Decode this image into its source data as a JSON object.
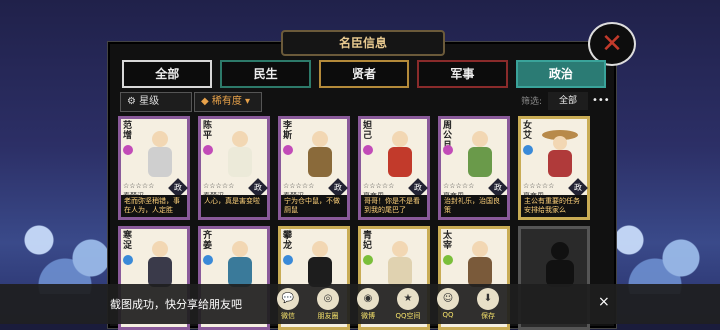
{
  "window": {
    "title": "名臣信息"
  },
  "tabs": [
    {
      "label": "全部"
    },
    {
      "label": "民生"
    },
    {
      "label": "贤者"
    },
    {
      "label": "军事"
    },
    {
      "label": "政治"
    }
  ],
  "toolbar": {
    "star_label": "星级",
    "rarity_label": "稀有度",
    "filter_label": "筛选:",
    "filter_value": "全部",
    "more_label": "•••"
  },
  "cards": [
    {
      "name": "范增",
      "dynasty": "秦楚汉",
      "badge": "政",
      "desc": "老而弥坚稍错，事在人为，人定胜",
      "frame": "purple"
    },
    {
      "name": "陈平",
      "dynasty": "秦楚汉",
      "badge": "政",
      "desc": "人心，真是害变啦",
      "frame": "purple"
    },
    {
      "name": "李斯",
      "dynasty": "秦楚汉",
      "badge": "政",
      "desc": "宁为仓中鼠，不做厕鼠",
      "frame": "purple"
    },
    {
      "name": "妲己",
      "dynasty": "夏商周",
      "badge": "政",
      "desc": "哥哥！你是不是看到我的尾巴了",
      "frame": "purple"
    },
    {
      "name": "周公旦",
      "dynasty": "夏商周",
      "badge": "政",
      "desc": "治封礼乐，治国良策",
      "frame": "purple"
    },
    {
      "name": "女艾",
      "dynasty": "夏商周",
      "badge": "政",
      "desc": "主公有重要的任务安排给我家么",
      "frame": "gold"
    },
    {
      "name": "寒浞",
      "dynasty": "",
      "badge": "",
      "desc": "",
      "frame": "purple"
    },
    {
      "name": "齐姜",
      "dynasty": "",
      "badge": "",
      "desc": "",
      "frame": "purple"
    },
    {
      "name": "攀龙",
      "dynasty": "",
      "badge": "",
      "desc": "",
      "frame": "gold"
    },
    {
      "name": "青妃",
      "dynasty": "",
      "badge": "",
      "desc": "",
      "frame": "gold"
    },
    {
      "name": "太宰",
      "dynasty": "",
      "badge": "",
      "desc": "",
      "frame": "gold"
    },
    {
      "name": "",
      "dynasty": "",
      "badge": "",
      "desc": "",
      "frame": "dark"
    }
  ],
  "share": {
    "message": "截图成功，快分享给朋友吧",
    "items": [
      {
        "label": "微信",
        "icon": "wechat-icon"
      },
      {
        "label": "朋友圈",
        "icon": "moments-icon"
      },
      {
        "label": "微博",
        "icon": "weibo-icon"
      },
      {
        "label": "QQ空间",
        "icon": "qzone-icon"
      },
      {
        "label": "QQ",
        "icon": "qq-icon"
      },
      {
        "label": "保存",
        "icon": "save-icon"
      }
    ],
    "close": "×"
  }
}
